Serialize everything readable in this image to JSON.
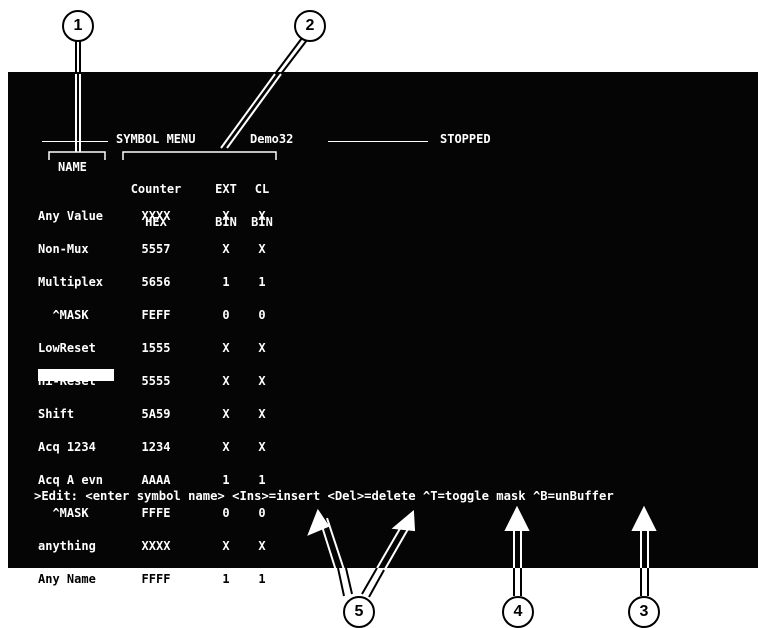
{
  "header": {
    "title": "SYMBOL MENU",
    "program": "Demo32",
    "status": "STOPPED"
  },
  "table": {
    "name_header": "NAME",
    "columns": [
      {
        "label": "Counter",
        "format": "HEX"
      },
      {
        "label": "EXT",
        "format": "BIN"
      },
      {
        "label": "CL",
        "format": "BIN"
      }
    ],
    "rows": [
      {
        "name": "Any Value",
        "counter": "XXXX",
        "ext": "X",
        "cl": "X"
      },
      {
        "name": "Non-Mux",
        "counter": "5557",
        "ext": "X",
        "cl": "X"
      },
      {
        "name": "Multiplex",
        "counter": "5656",
        "ext": "1",
        "cl": "1"
      },
      {
        "name": "  ^MASK",
        "counter": "FEFF",
        "ext": "0",
        "cl": "0"
      },
      {
        "name": "LowReset",
        "counter": "1555",
        "ext": "X",
        "cl": "X"
      },
      {
        "name": "Hi-Reset",
        "counter": "5555",
        "ext": "X",
        "cl": "X"
      },
      {
        "name": "Shift",
        "counter": "5A59",
        "ext": "X",
        "cl": "X"
      },
      {
        "name": "Acq 1234",
        "counter": "1234",
        "ext": "X",
        "cl": "X"
      },
      {
        "name": "Acq A evn",
        "counter": "AAAA",
        "ext": "1",
        "cl": "1"
      },
      {
        "name": "  ^MASK",
        "counter": "FFFE",
        "ext": "0",
        "cl": "0"
      },
      {
        "name": "anything",
        "counter": "XXXX",
        "ext": "X",
        "cl": "X"
      },
      {
        "name": "Any Name",
        "counter": "FFFF",
        "ext": "1",
        "cl": "1"
      }
    ]
  },
  "status_line": ">Edit: <enter symbol name> <Ins>=insert <Del>=delete ^T=toggle mask ^B=unBuffer",
  "callouts": [
    "1",
    "2",
    "3",
    "4",
    "5"
  ]
}
